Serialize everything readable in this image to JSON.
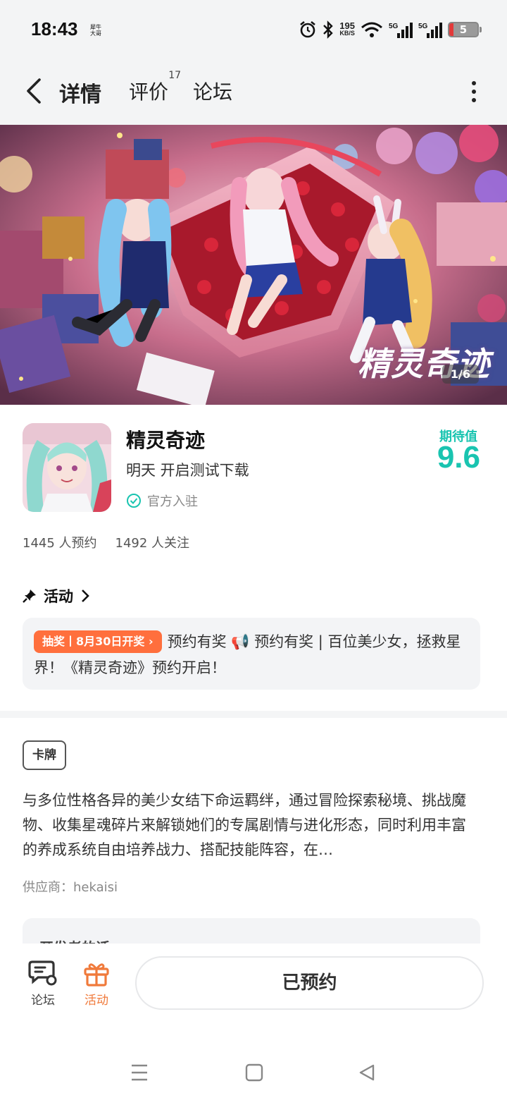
{
  "status_bar": {
    "time": "18:43",
    "mini_text": "犀牛大哥",
    "network_speed": "195",
    "network_unit": "KB/S",
    "battery": "5"
  },
  "nav": {
    "tabs": [
      {
        "label": "详情",
        "active": true
      },
      {
        "label": "评价",
        "count": "17"
      },
      {
        "label": "论坛"
      }
    ]
  },
  "banner": {
    "title": "精灵奇迹",
    "indicator": "1/6"
  },
  "app": {
    "name": "精灵奇迹",
    "status": "明天 开启测试下载",
    "official": "官方入驻",
    "expect_label": "期待值",
    "expect_score": "9.6",
    "reservations": "1445 人预约",
    "followers": "1492 人关注"
  },
  "activity": {
    "heading": "活动",
    "tag": "抽奖丨8月30日开奖",
    "text": "预约有奖 📢 预约有奖 | 百位美少女，拯救星界！《精灵奇迹》预约开启！"
  },
  "description": {
    "genre": "卡牌",
    "text": "与多位性格各异的美少女结下命运羁绊，通过冒险探索秘境、挑战魔物、收集星魂碎片来解锁她们的专属剧情与进化形态，同时利用丰富的养成系统自由培养战力、搭配技能阵容，在…",
    "supplier": "供应商：hekaisi",
    "peek": "开发者的话"
  },
  "bottom_bar": {
    "forum_label": "论坛",
    "activity_label": "活动",
    "reserve_label": "已预约"
  },
  "colors": {
    "accent": "#19c4b0",
    "tab_underline": "#18d5c2",
    "lottery": "#ff6f3d",
    "activity_icon": "#f07a3b"
  }
}
